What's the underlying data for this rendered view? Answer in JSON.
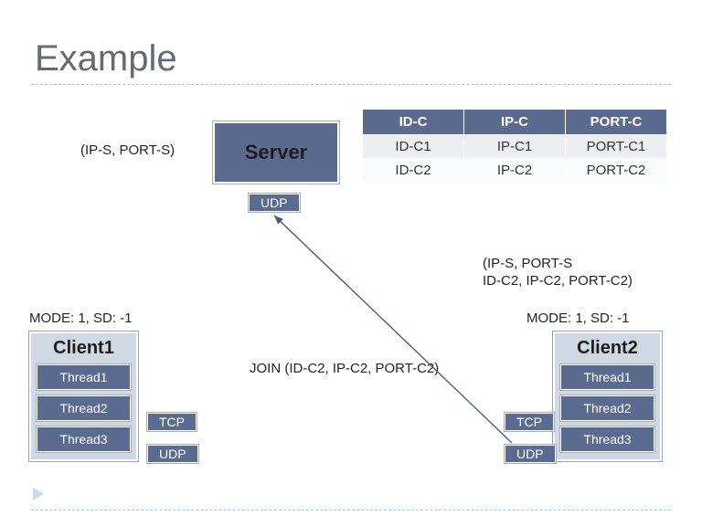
{
  "title": "Example",
  "server": {
    "label": "Server",
    "addr": "(IP-S, PORT-S)",
    "proto": "UDP"
  },
  "table": {
    "headers": [
      "ID-C",
      "IP-C",
      "PORT-C"
    ],
    "rows": [
      [
        "ID-C1",
        "IP-C1",
        "PORT-C1"
      ],
      [
        "ID-C2",
        "IP-C2",
        "PORT-C2"
      ]
    ]
  },
  "notes": {
    "right_params": "(IP-S, PORT-S\nID-C2, IP-C2, PORT-C2)",
    "join_msg": "JOIN (ID-C2, IP-C2, PORT-C2)"
  },
  "client1": {
    "mode": "MODE: 1, SD: -1",
    "title": "Client1",
    "threads": [
      "Thread1",
      "Thread2",
      "Thread3"
    ],
    "tcp": "TCP",
    "udp": "UDP"
  },
  "client2": {
    "mode": "MODE: 1, SD: -1",
    "title": "Client2",
    "threads": [
      "Thread1",
      "Thread2",
      "Thread3"
    ],
    "tcp": "TCP",
    "udp": "UDP"
  }
}
